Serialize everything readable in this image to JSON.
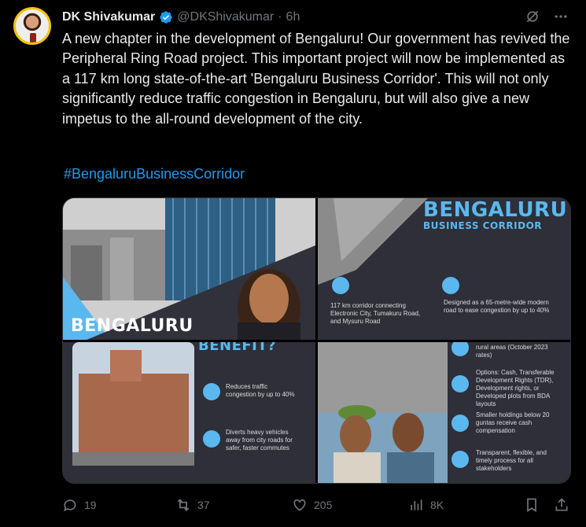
{
  "author": {
    "name": "DK Shivakumar",
    "handle": "@DKShivakumar",
    "separator": "·",
    "time": "6h"
  },
  "tweet": {
    "text": "A new chapter in the development of Bengaluru! Our government has revived the Peripheral Ring Road project. This important project will now be implemented as a 117 km long state-of-the-art 'Bengaluru Business Corridor'. This will not only significantly reduce traffic congestion in Bengaluru, but will also give a new impetus to the all-round development of the city.",
    "hashtag": "#BengaluruBusinessCorridor"
  },
  "media": {
    "tile1": {
      "title": "BENGALURU"
    },
    "tile2": {
      "title_line1": "BENGALURU",
      "title_line2": "BUSINESS CORRIDOR",
      "point1": "117 km corridor connecting Electronic City, Tumakuru Road, and Mysuru Road",
      "point2": "Designed as a 65-metre-wide modern road to ease congestion by up to 40%"
    },
    "tile3": {
      "title": "BENEFIT?",
      "point1": "Reduces traffic congestion by up to 40%",
      "point2": "Diverts heavy vehicles away from city roads for safer, faster commutes"
    },
    "tile4": {
      "point0": "rural areas (October 2023 rates)",
      "point1": "Options: Cash, Transferable Development Rights (TDR), Development rights, or Developed plots from BDA layouts",
      "point2": "Smaller holdings below 20 guntas receive cash compensation",
      "point3": "Transparent, flexible, and timely process for all stakeholders"
    }
  },
  "actions": {
    "replies": "19",
    "reposts": "37",
    "likes": "205",
    "views": "8K"
  },
  "colors": {
    "link": "#1d9bf0",
    "muted": "#71767b",
    "accent_blue": "#5bb8ee",
    "verified": "#1d9bf0"
  }
}
